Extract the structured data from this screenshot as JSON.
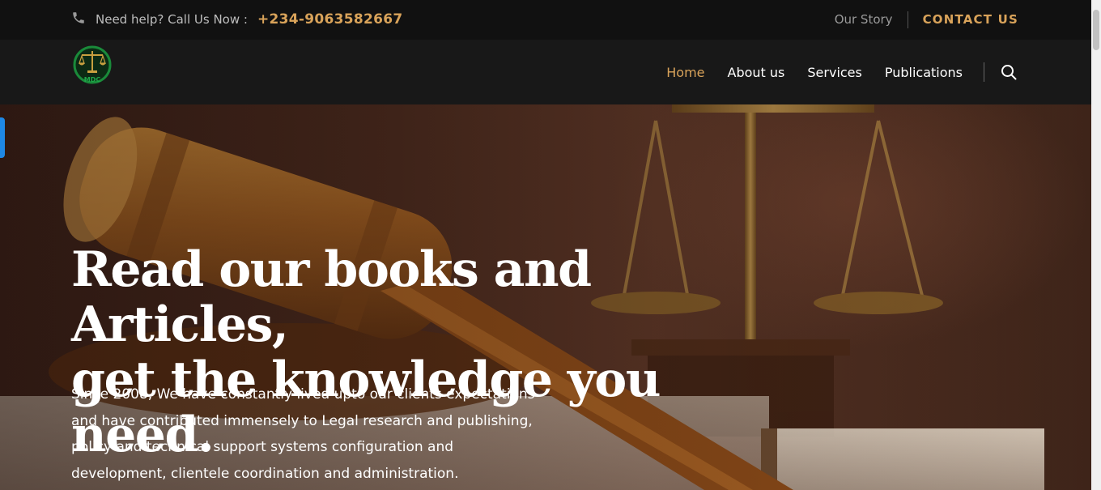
{
  "topbar": {
    "help_label": "Need help? Call Us Now :",
    "phone": "+234-9063582667",
    "our_story": "Our Story",
    "contact": "CONTACT US"
  },
  "logo": {
    "text": "MDC"
  },
  "nav": {
    "items": [
      {
        "label": "Home",
        "active": true
      },
      {
        "label": "About us",
        "active": false
      },
      {
        "label": "Services",
        "active": false
      },
      {
        "label": "Publications",
        "active": false
      }
    ],
    "search_icon": "search-icon"
  },
  "hero": {
    "headline_line1": "Read our books and Articles,",
    "headline_line2": "get the knowledge you need.",
    "subtext": "Since 2008, We have constantly lived upto our clients expectations and have contributed immensely to Legal research and publishing, policy and technical support systems configuration and development, clientele coordination and administration."
  },
  "colors": {
    "accent": "#d9a35a",
    "topbar_bg": "#111111",
    "navbar_bg": "#181818",
    "logo_green": "#1a8a3a"
  }
}
